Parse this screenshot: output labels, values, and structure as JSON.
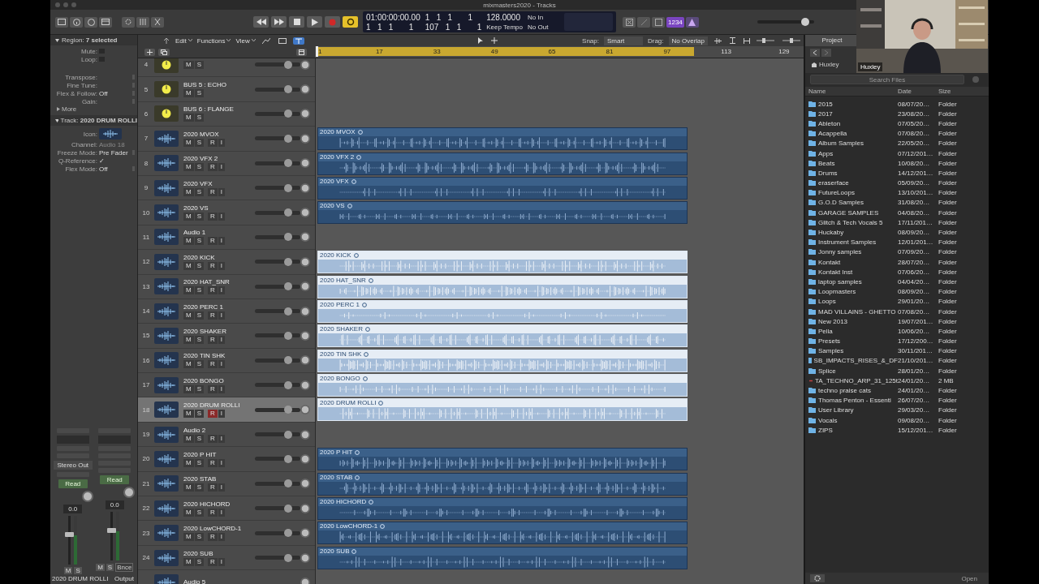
{
  "window": {
    "title": "mixmasters2020 - Tracks"
  },
  "toolbar": {
    "cycle_on": true,
    "count_in": "1234",
    "master_volume": {
      "level": 0.85
    },
    "lcd": {
      "time": "01:00:00:00.00",
      "bars_top": "1   1   1       1",
      "tempo": "128.0000",
      "input": "No In",
      "bars_bottom": "1   1   1       1",
      "position": "107   1   1       1",
      "tempo_mode": "Keep Tempo",
      "output": "No Out"
    }
  },
  "inspector": {
    "region_header": "Region: **7 selected**",
    "region_fields": [
      {
        "label": "Mute:",
        "kind": "check",
        "checked": false
      },
      {
        "label": "Loop:",
        "kind": "check",
        "checked": false
      },
      {
        "label": "Transpose:",
        "kind": "stepper"
      },
      {
        "label": "Fine Tune:",
        "kind": "stepper"
      },
      {
        "label": "Flex & Follow:",
        "value": "Off",
        "kind": "stepper"
      },
      {
        "label": "Gain:",
        "kind": "stepper"
      }
    ],
    "more": "More",
    "track_header": "Track: **2020 DRUM ROLLI**",
    "track_fields": [
      {
        "label": "Icon:",
        "kind": "icon"
      },
      {
        "label": "Channel:",
        "value": "Audio 18",
        "kind": "dim"
      },
      {
        "label": "Freeze Mode:",
        "value": "Pre Fader",
        "kind": "stepper"
      },
      {
        "label": "Q-Reference:",
        "value": "✓",
        "kind": "plain"
      },
      {
        "label": "Flex Mode:",
        "value": "Off",
        "kind": "stepper"
      }
    ],
    "strips": [
      {
        "slot": "Stereo Out",
        "automation": "Read",
        "value": "0.0",
        "buttons": [
          "M",
          "S"
        ],
        "name": "2020 DRUM ROLLI",
        "level": 0.62
      },
      {
        "automation": "Read",
        "value": "0.0",
        "buttons": [
          "M",
          "S"
        ],
        "extra": "Bnce",
        "name": "Output",
        "level": 0.62
      }
    ]
  },
  "menu": {
    "items": [
      "Edit",
      "Functions",
      "View"
    ],
    "snap_label": "Snap:",
    "snap": "Smart",
    "drag_label": "Drag:",
    "drag": "No Overlap",
    "zoom_sliders": [
      {
        "level": 0.4
      },
      {
        "level": 0.5
      }
    ]
  },
  "ruler": [
    "1",
    "17",
    "33",
    "49",
    "65",
    "81",
    "97",
    "113",
    "129"
  ],
  "tracks": [
    {
      "number": "4",
      "kind": "bus",
      "buttons": [
        "M",
        "S"
      ],
      "selected": false,
      "level": 0.73
    },
    {
      "number": "5",
      "name": "BUS 5 : ECHO",
      "kind": "bus",
      "buttons": [
        "M",
        "S"
      ],
      "selected": false,
      "level": 0.73
    },
    {
      "number": "6",
      "name": "BUS 6 : FLANGE",
      "kind": "bus",
      "buttons": [
        "M",
        "S"
      ],
      "selected": false,
      "level": 0.73
    },
    {
      "number": "7",
      "name": "2020 MVOX",
      "kind": "audio",
      "buttons": [
        "M",
        "S",
        "R",
        "I"
      ],
      "armed": false,
      "selected": false,
      "level": 0.73,
      "region": {
        "name": "2020 MVOX",
        "selected": false
      }
    },
    {
      "number": "8",
      "name": "2020 VFX 2",
      "kind": "audio",
      "buttons": [
        "M",
        "S",
        "R",
        "I"
      ],
      "armed": false,
      "selected": false,
      "level": 0.73,
      "region": {
        "name": "2020 VFX 2",
        "selected": false
      }
    },
    {
      "number": "9",
      "name": "2020 VFX",
      "kind": "audio",
      "buttons": [
        "M",
        "S",
        "R",
        "I"
      ],
      "armed": false,
      "selected": false,
      "level": 0.73,
      "region": {
        "name": "2020 VFX",
        "selected": false
      }
    },
    {
      "number": "10",
      "name": "2020 VS",
      "kind": "audio",
      "buttons": [
        "M",
        "S",
        "R",
        "I"
      ],
      "armed": false,
      "selected": false,
      "level": 0.73,
      "region": {
        "name": "2020 VS",
        "selected": false
      }
    },
    {
      "number": "11",
      "name": "Audio 1",
      "kind": "audio",
      "buttons": [
        "M",
        "S",
        "R",
        "I"
      ],
      "armed": false,
      "selected": false,
      "level": 0.73
    },
    {
      "number": "12",
      "name": "2020 KICK",
      "kind": "audio",
      "buttons": [
        "M",
        "S",
        "R",
        "I"
      ],
      "armed": false,
      "selected": false,
      "level": 0.73,
      "region": {
        "name": "2020 KICK",
        "selected": true
      }
    },
    {
      "number": "13",
      "name": "2020 HAT_SNR",
      "kind": "audio",
      "buttons": [
        "M",
        "S",
        "R",
        "I"
      ],
      "armed": false,
      "selected": false,
      "level": 0.73,
      "region": {
        "name": "2020 HAT_SNR",
        "selected": true
      }
    },
    {
      "number": "14",
      "name": "2020 PERC 1",
      "kind": "audio",
      "buttons": [
        "M",
        "S",
        "R",
        "I"
      ],
      "armed": false,
      "selected": false,
      "level": 0.73,
      "region": {
        "name": "2020 PERC 1",
        "selected": true
      }
    },
    {
      "number": "15",
      "name": "2020 SHAKER",
      "kind": "audio",
      "buttons": [
        "M",
        "S",
        "R",
        "I"
      ],
      "armed": false,
      "selected": false,
      "level": 0.73,
      "region": {
        "name": "2020 SHAKER",
        "selected": true
      }
    },
    {
      "number": "16",
      "name": "2020 TIN SHK",
      "kind": "audio",
      "buttons": [
        "M",
        "S",
        "R",
        "I"
      ],
      "armed": false,
      "selected": false,
      "level": 0.73,
      "region": {
        "name": "2020 TIN SHK",
        "selected": true
      }
    },
    {
      "number": "17",
      "name": "2020 BONGO",
      "kind": "audio",
      "buttons": [
        "M",
        "S",
        "R",
        "I"
      ],
      "armed": false,
      "selected": false,
      "level": 0.73,
      "region": {
        "name": "2020 BONGO",
        "selected": true
      }
    },
    {
      "number": "18",
      "name": "2020 DRUM ROLLI",
      "kind": "audio",
      "buttons": [
        "M",
        "S",
        "R",
        "I"
      ],
      "armed": true,
      "selected": true,
      "level": 0.73,
      "region": {
        "name": "2020 DRUM ROLLI",
        "selected": true
      }
    },
    {
      "number": "19",
      "name": "Audio 2",
      "kind": "audio",
      "buttons": [
        "M",
        "S",
        "R",
        "I"
      ],
      "armed": false,
      "selected": false,
      "level": 0.73
    },
    {
      "number": "20",
      "name": "2020 P HIT",
      "kind": "audio",
      "buttons": [
        "M",
        "S",
        "R",
        "I"
      ],
      "armed": false,
      "selected": false,
      "level": 0.73,
      "region": {
        "name": "2020 P HIT",
        "selected": false
      }
    },
    {
      "number": "21",
      "name": "2020 STAB",
      "kind": "audio",
      "buttons": [
        "M",
        "S",
        "R",
        "I"
      ],
      "armed": false,
      "selected": false,
      "level": 0.73,
      "region": {
        "name": "2020 STAB",
        "selected": false
      }
    },
    {
      "number": "22",
      "name": "2020 HICHORD",
      "kind": "audio",
      "buttons": [
        "M",
        "S",
        "R",
        "I"
      ],
      "armed": false,
      "selected": false,
      "level": 0.73,
      "region": {
        "name": "2020 HICHORD",
        "selected": false
      }
    },
    {
      "number": "23",
      "name": "2020 LowCHORD-1",
      "kind": "audio",
      "buttons": [
        "M",
        "S",
        "R",
        "I"
      ],
      "armed": false,
      "selected": false,
      "level": 0.73,
      "region": {
        "name": "2020 LowCHORD-1",
        "selected": false
      }
    },
    {
      "number": "24",
      "name": "2020 SUB",
      "kind": "audio",
      "buttons": [
        "M",
        "S",
        "R",
        "I"
      ],
      "armed": false,
      "selected": false,
      "level": 0.73,
      "region": {
        "name": "2020 SUB",
        "selected": false
      }
    },
    {
      "name": "Audio 5",
      "kind": "audio",
      "selected": false
    }
  ],
  "browser": {
    "tab": "Project",
    "path": "Huxley",
    "search_placeholder": "Search Files",
    "columns": [
      "Name",
      "Date",
      "Size"
    ],
    "rows": [
      {
        "name": "2015",
        "date": "08/07/20…",
        "size": "Folder",
        "kind": "folder"
      },
      {
        "name": "2017",
        "date": "23/08/20…",
        "size": "Folder",
        "kind": "folder"
      },
      {
        "name": "Ableton",
        "date": "07/05/20…",
        "size": "Folder",
        "kind": "folder"
      },
      {
        "name": "Acappella",
        "date": "07/08/20…",
        "size": "Folder",
        "kind": "folder"
      },
      {
        "name": "Album Samples",
        "date": "22/05/20…",
        "size": "Folder",
        "kind": "folder"
      },
      {
        "name": "Apps",
        "date": "07/12/201…",
        "size": "Folder",
        "kind": "folder"
      },
      {
        "name": "Beats",
        "date": "10/08/20…",
        "size": "Folder",
        "kind": "folder"
      },
      {
        "name": "Drums",
        "date": "14/12/201…",
        "size": "Folder",
        "kind": "folder"
      },
      {
        "name": "eraserface",
        "date": "05/09/20…",
        "size": "Folder",
        "kind": "folder"
      },
      {
        "name": "FutureLoops",
        "date": "13/10/201…",
        "size": "Folder",
        "kind": "folder"
      },
      {
        "name": "G.O.D Samples",
        "date": "31/08/20…",
        "size": "Folder",
        "kind": "folder"
      },
      {
        "name": "GARAGE SAMPLES",
        "date": "04/08/20…",
        "size": "Folder",
        "kind": "folder"
      },
      {
        "name": "Glitch & Tech Vocals 5",
        "date": "17/11/201…",
        "size": "Folder",
        "kind": "folder"
      },
      {
        "name": "Huckaby",
        "date": "08/09/20…",
        "size": "Folder",
        "kind": "folder"
      },
      {
        "name": "Instrument Samples",
        "date": "12/01/201…",
        "size": "Folder",
        "kind": "folder"
      },
      {
        "name": "Jonny samples",
        "date": "07/09/20…",
        "size": "Folder",
        "kind": "folder"
      },
      {
        "name": "Kontakt",
        "date": "28/07/20…",
        "size": "Folder",
        "kind": "folder"
      },
      {
        "name": "Kontakt Inst",
        "date": "07/06/20…",
        "size": "Folder",
        "kind": "folder"
      },
      {
        "name": "laptop samples",
        "date": "04/04/20…",
        "size": "Folder",
        "kind": "folder"
      },
      {
        "name": "Loopmasters",
        "date": "08/09/20…",
        "size": "Folder",
        "kind": "folder"
      },
      {
        "name": "Loops",
        "date": "29/01/20…",
        "size": "Folder",
        "kind": "folder"
      },
      {
        "name": "MAD VILLAINS - GHETTO",
        "date": "07/08/20…",
        "size": "Folder",
        "kind": "folder"
      },
      {
        "name": "New 2013",
        "date": "19/07/201…",
        "size": "Folder",
        "kind": "folder"
      },
      {
        "name": "Pella",
        "date": "10/06/20…",
        "size": "Folder",
        "kind": "folder"
      },
      {
        "name": "Presets",
        "date": "17/12/200…",
        "size": "Folder",
        "kind": "folder"
      },
      {
        "name": "Samples",
        "date": "30/11/201…",
        "size": "Folder",
        "kind": "folder"
      },
      {
        "name": "SB_IMPACTS_RISES_&_DF",
        "date": "21/10/201…",
        "size": "Folder",
        "kind": "folder"
      },
      {
        "name": "Splice",
        "date": "28/01/20…",
        "size": "Folder",
        "kind": "folder"
      },
      {
        "name": "TA_TECHNO_ARP_31_125t",
        "date": "24/01/20…",
        "size": "2 MB",
        "kind": "file"
      },
      {
        "name": "techno praise cats",
        "date": "24/01/20…",
        "size": "Folder",
        "kind": "folder"
      },
      {
        "name": "Thomas Penton - Essenti",
        "date": "26/07/20…",
        "size": "Folder",
        "kind": "folder"
      },
      {
        "name": "User Library",
        "date": "29/03/20…",
        "size": "Folder",
        "kind": "folder"
      },
      {
        "name": "Vocals",
        "date": "09/08/20…",
        "size": "Folder",
        "kind": "folder"
      },
      {
        "name": "ZIPS",
        "date": "15/12/201…",
        "size": "Folder",
        "kind": "folder"
      }
    ],
    "open_button": "Open"
  },
  "webcam": {
    "label": "Huxley"
  }
}
